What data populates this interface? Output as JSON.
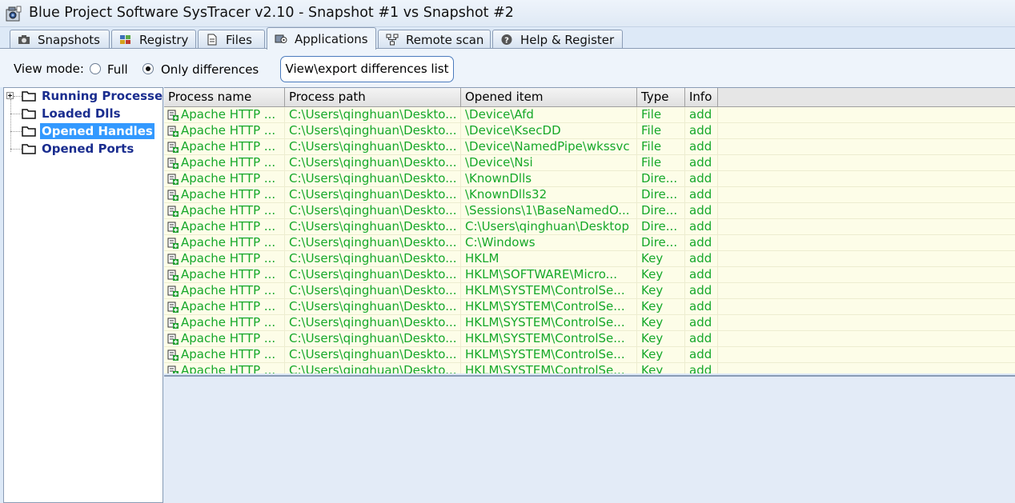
{
  "window": {
    "title": "Blue Project Software SysTracer v2.10 - Snapshot #1 vs Snapshot #2"
  },
  "tabs": [
    {
      "label": "Snapshots",
      "icon": "camera-icon"
    },
    {
      "label": "Registry",
      "icon": "registry-icon"
    },
    {
      "label": "Files",
      "icon": "file-icon"
    },
    {
      "label": "Applications",
      "icon": "applications-icon",
      "active": true
    },
    {
      "label": "Remote scan",
      "icon": "network-icon"
    },
    {
      "label": "Help & Register",
      "icon": "help-icon"
    }
  ],
  "toolbar": {
    "view_mode_label": "View mode:",
    "option_full": "Full",
    "option_diff": "Only differences",
    "selected": "Only differences",
    "export_button": "View\\export differences list"
  },
  "tree": {
    "items": [
      {
        "label": "Running Processes",
        "expandable": true
      },
      {
        "label": "Loaded Dlls"
      },
      {
        "label": "Opened Handles",
        "selected": true
      },
      {
        "label": "Opened Ports"
      }
    ]
  },
  "grid": {
    "columns": [
      "Process name",
      "Process path",
      "Opened item",
      "Type",
      "Info"
    ],
    "rows": [
      [
        "Apache HTTP ...",
        "C:\\Users\\qinghuan\\Deskto...",
        "\\Device\\Afd",
        "File",
        "add"
      ],
      [
        "Apache HTTP ...",
        "C:\\Users\\qinghuan\\Deskto...",
        "\\Device\\KsecDD",
        "File",
        "add"
      ],
      [
        "Apache HTTP ...",
        "C:\\Users\\qinghuan\\Deskto...",
        "\\Device\\NamedPipe\\wkssvc",
        "File",
        "add"
      ],
      [
        "Apache HTTP ...",
        "C:\\Users\\qinghuan\\Deskto...",
        "\\Device\\Nsi",
        "File",
        "add"
      ],
      [
        "Apache HTTP ...",
        "C:\\Users\\qinghuan\\Deskto...",
        "\\KnownDlls",
        "Dire...",
        "add"
      ],
      [
        "Apache HTTP ...",
        "C:\\Users\\qinghuan\\Deskto...",
        "\\KnownDlls32",
        "Dire...",
        "add"
      ],
      [
        "Apache HTTP ...",
        "C:\\Users\\qinghuan\\Deskto...",
        "\\Sessions\\1\\BaseNamedO...",
        "Dire...",
        "add"
      ],
      [
        "Apache HTTP ...",
        "C:\\Users\\qinghuan\\Deskto...",
        "C:\\Users\\qinghuan\\Desktop",
        "Dire...",
        "add"
      ],
      [
        "Apache HTTP ...",
        "C:\\Users\\qinghuan\\Deskto...",
        "C:\\Windows",
        "Dire...",
        "add"
      ],
      [
        "Apache HTTP ...",
        "C:\\Users\\qinghuan\\Deskto...",
        "HKLM",
        "Key",
        "add"
      ],
      [
        "Apache HTTP ...",
        "C:\\Users\\qinghuan\\Deskto...",
        "HKLM\\SOFTWARE\\Micro...",
        "Key",
        "add"
      ],
      [
        "Apache HTTP ...",
        "C:\\Users\\qinghuan\\Deskto...",
        "HKLM\\SYSTEM\\ControlSe...",
        "Key",
        "add"
      ],
      [
        "Apache HTTP ...",
        "C:\\Users\\qinghuan\\Deskto...",
        "HKLM\\SYSTEM\\ControlSe...",
        "Key",
        "add"
      ],
      [
        "Apache HTTP ...",
        "C:\\Users\\qinghuan\\Deskto...",
        "HKLM\\SYSTEM\\ControlSe...",
        "Key",
        "add"
      ],
      [
        "Apache HTTP ...",
        "C:\\Users\\qinghuan\\Deskto...",
        "HKLM\\SYSTEM\\ControlSe...",
        "Key",
        "add"
      ],
      [
        "Apache HTTP ...",
        "C:\\Users\\qinghuan\\Deskto...",
        "HKLM\\SYSTEM\\ControlSe...",
        "Key",
        "add"
      ],
      [
        "Apache HTTP ...",
        "C:\\Users\\qinghuan\\Deskto...",
        "HKLM\\SYSTEM\\ControlSe...",
        "Key",
        "add"
      ]
    ]
  },
  "colors": {
    "added_text": "#16a82a",
    "row_background": "#fdfde8",
    "tree_text": "#1a2d8f",
    "selection": "#3399ff"
  }
}
